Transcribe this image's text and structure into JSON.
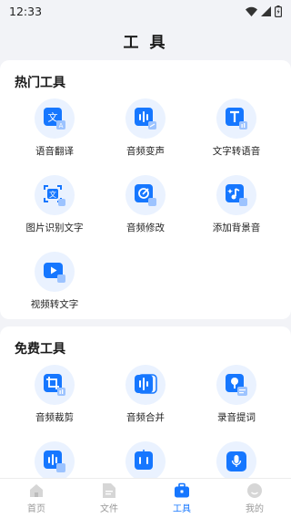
{
  "status_bar": {
    "time": "12:33"
  },
  "header": {
    "title": "工 具"
  },
  "hot_tools": {
    "title": "热门工具",
    "items": [
      {
        "label": "语音翻译",
        "icon": "translate-icon"
      },
      {
        "label": "音频变声",
        "icon": "voice-change-icon"
      },
      {
        "label": "文字转语音",
        "icon": "text-to-speech-icon"
      },
      {
        "label": "图片识别文字",
        "icon": "ocr-icon"
      },
      {
        "label": "音频修改",
        "icon": "audio-edit-icon"
      },
      {
        "label": "添加背景音",
        "icon": "background-music-icon"
      },
      {
        "label": "视频转文字",
        "icon": "video-to-text-icon"
      }
    ]
  },
  "free_tools": {
    "title": "免费工具",
    "items": [
      {
        "label": "音频裁剪",
        "icon": "audio-crop-icon"
      },
      {
        "label": "音频合并",
        "icon": "audio-merge-icon"
      },
      {
        "label": "录音提词",
        "icon": "teleprompter-icon"
      }
    ]
  },
  "tabbar": {
    "items": [
      {
        "label": "首页",
        "icon": "home-icon",
        "active": false
      },
      {
        "label": "文件",
        "icon": "file-icon",
        "active": false
      },
      {
        "label": "工具",
        "icon": "toolbox-icon",
        "active": true
      },
      {
        "label": "我的",
        "icon": "profile-icon",
        "active": false
      }
    ]
  },
  "colors": {
    "accent": "#1677ff",
    "icon_bg": "#eaf2ff",
    "inactive": "#9a9a9a"
  }
}
